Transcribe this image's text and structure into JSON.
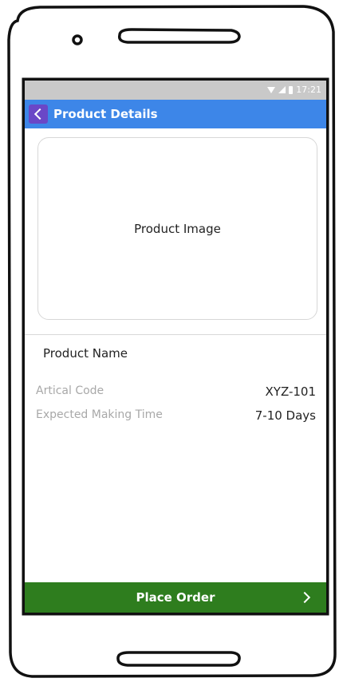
{
  "status_bar": {
    "time": "17:21",
    "icons": [
      "wifi-icon",
      "signal-icon",
      "battery-icon"
    ]
  },
  "header": {
    "back_icon": "chevron-left-icon",
    "title": "Product Details",
    "background": "#3d86e8",
    "back_button_color": "#6a47c7"
  },
  "product": {
    "image_placeholder": "Product Image",
    "name": "Product Name",
    "details": [
      {
        "label": "Artical Code",
        "value": "XYZ-101"
      },
      {
        "label": "Expected Making Time",
        "value": "7-10 Days"
      }
    ]
  },
  "footer": {
    "button_label": "Place Order",
    "button_icon": "chevron-right-icon",
    "background": "#2e7d1e"
  }
}
